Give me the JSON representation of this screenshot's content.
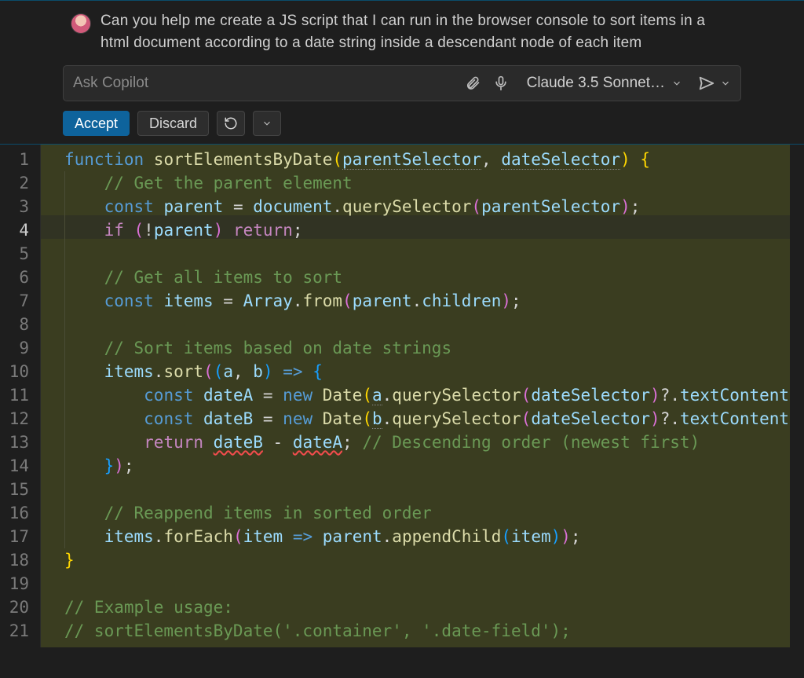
{
  "chat": {
    "message": "Can you help me create a JS script that I can run in the browser console to sort items in a html document according to a date string inside a descendant node of each item"
  },
  "input": {
    "placeholder": "Ask Copilot",
    "model": "Claude 3.5 Sonnet…"
  },
  "actions": {
    "accept": "Accept",
    "discard": "Discard"
  },
  "gutter": [
    "1",
    "2",
    "3",
    "4",
    "5",
    "6",
    "7",
    "8",
    "9",
    "10",
    "11",
    "12",
    "13",
    "14",
    "15",
    "16",
    "17",
    "18",
    "19",
    "20",
    "21"
  ],
  "code": {
    "l1": {
      "kw": "function ",
      "fn": "sortElementsByDate",
      "p1": "(",
      "a1": "parentSelector",
      "c1": ", ",
      "a2": "dateSelector",
      "p2": ") ",
      "br": "{"
    },
    "l2": {
      "indent": "    ",
      "cmt": "// Get the parent element"
    },
    "l3": {
      "indent": "    ",
      "kw": "const ",
      "v": "parent",
      "eq": " = ",
      "obj": "document",
      "dot": ".",
      "fn": "querySelector",
      "p1": "(",
      "arg": "parentSelector",
      "p2": ")",
      "sc": ";"
    },
    "l4": {
      "indent": "    ",
      "kw": "if ",
      "p1": "(",
      "not": "!",
      "v": "parent",
      "p2": ") ",
      "ret": "return",
      "sc": ";"
    },
    "l5": {
      "blank": ""
    },
    "l6": {
      "indent": "    ",
      "cmt": "// Get all items to sort"
    },
    "l7": {
      "indent": "    ",
      "kw": "const ",
      "v": "items",
      "eq": " = ",
      "obj": "Array",
      "dot": ".",
      "fn": "from",
      "p1": "(",
      "a1": "parent",
      "dot2": ".",
      "a2": "children",
      "p2": ")",
      "sc": ";"
    },
    "l8": {
      "blank": ""
    },
    "l9": {
      "indent": "    ",
      "cmt": "// Sort items based on date strings"
    },
    "l10": {
      "indent": "    ",
      "v": "items",
      "dot": ".",
      "fn": "sort",
      "p1": "(",
      "p2": "(",
      "a": "a",
      "c": ", ",
      "b": "b",
      "p3": ")",
      "ar": " => ",
      "br": "{"
    },
    "l11": {
      "indent": "        ",
      "kw": "const ",
      "v": "dateA",
      "eq": " = ",
      "nw": "new ",
      "cls": "Date",
      "p1": "(",
      "a": "a",
      "dot": ".",
      "fn": "querySelector",
      "p2": "(",
      "arg": "dateSelector",
      "p3": ")",
      "opt": "?.",
      "prop": "textContent",
      "or": " || "
    },
    "l12": {
      "indent": "        ",
      "kw": "const ",
      "v": "dateB",
      "eq": " = ",
      "nw": "new ",
      "cls": "Date",
      "p1": "(",
      "a": "b",
      "dot": ".",
      "fn": "querySelector",
      "p2": "(",
      "arg": "dateSelector",
      "p3": ")",
      "opt": "?.",
      "prop": "textContent",
      "or": " || "
    },
    "l13": {
      "indent": "        ",
      "ret": "return ",
      "a": "dateB",
      "op": " - ",
      "b": "dateA",
      "sc": "; ",
      "cmt": "// Descending order (newest first)"
    },
    "l14": {
      "indent": "    ",
      "br": "}",
      "p": ")",
      "sc": ";"
    },
    "l15": {
      "blank": ""
    },
    "l16": {
      "indent": "    ",
      "cmt": "// Reappend items in sorted order"
    },
    "l17": {
      "indent": "    ",
      "v": "items",
      "dot": ".",
      "fn": "forEach",
      "p1": "(",
      "arg": "item",
      "ar": " => ",
      "obj": "parent",
      "dot2": ".",
      "fn2": "appendChild",
      "p2": "(",
      "arg2": "item",
      "p3": ")",
      "p4": ")",
      "sc": ";"
    },
    "l18": {
      "br": "}"
    },
    "l19": {
      "blank": ""
    },
    "l20": {
      "cmt": "// Example usage:"
    },
    "l21": {
      "cmt": "// sortElementsByDate('.container', '.date-field');"
    }
  }
}
